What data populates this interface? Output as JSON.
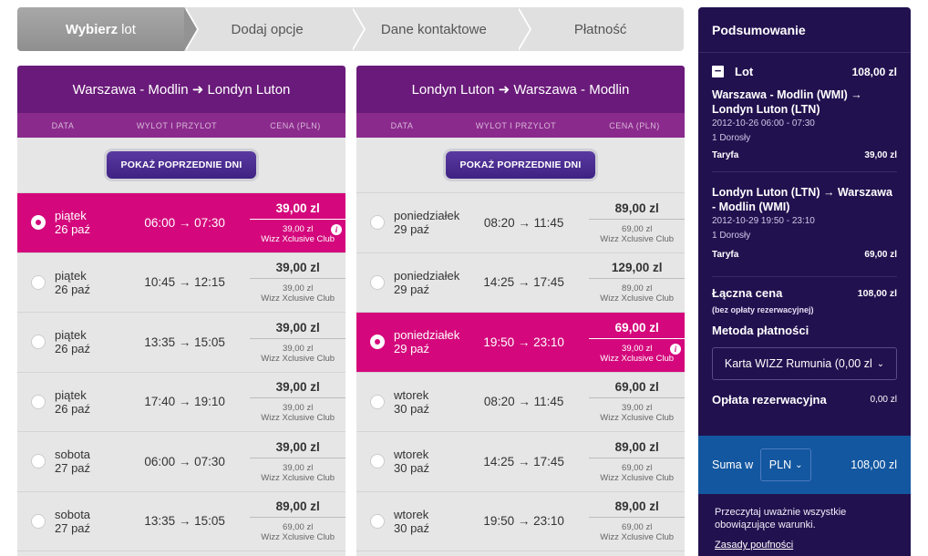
{
  "steps": [
    {
      "bold": "Wybierz",
      "rest": "lot",
      "active": true
    },
    {
      "bold": "",
      "rest": "Dodaj opcje",
      "active": false
    },
    {
      "bold": "",
      "rest": "Dane kontaktowe",
      "active": false
    },
    {
      "bold": "",
      "rest": "Płatność",
      "active": false
    }
  ],
  "outbound": {
    "route": "Warszawa - Modlin ➜ Londyn Luton",
    "col_date": "DATA",
    "col_times": "WYLOT I PRZYLOT",
    "col_price": "CENA (PLN)",
    "prev_label": "POKAŻ POPRZEDNIE DNI",
    "rows": [
      {
        "day": "piątek",
        "date": "26 paź",
        "times": "06:00 → 07:30",
        "price": "39,00 zl",
        "club_price": "39,00 zl",
        "club": "Wizz Xclusive Club",
        "selected": true
      },
      {
        "day": "piątek",
        "date": "26 paź",
        "times": "10:45 → 12:15",
        "price": "39,00 zl",
        "club_price": "39,00 zl",
        "club": "Wizz Xclusive Club",
        "selected": false
      },
      {
        "day": "piątek",
        "date": "26 paź",
        "times": "13:35 → 15:05",
        "price": "39,00 zl",
        "club_price": "39,00 zl",
        "club": "Wizz Xclusive Club",
        "selected": false
      },
      {
        "day": "piątek",
        "date": "26 paź",
        "times": "17:40 → 19:10",
        "price": "39,00 zl",
        "club_price": "39,00 zl",
        "club": "Wizz Xclusive Club",
        "selected": false
      },
      {
        "day": "sobota",
        "date": "27 paź",
        "times": "06:00 → 07:30",
        "price": "39,00 zl",
        "club_price": "39,00 zl",
        "club": "Wizz Xclusive Club",
        "selected": false
      },
      {
        "day": "sobota",
        "date": "27 paź",
        "times": "13:35 → 15:05",
        "price": "89,00 zl",
        "club_price": "69,00 zl",
        "club": "Wizz Xclusive Club",
        "selected": false
      }
    ]
  },
  "inbound": {
    "route": "Londyn Luton ➜ Warszawa - Modlin",
    "col_date": "DATA",
    "col_times": "WYLOT I PRZYLOT",
    "col_price": "CENA (PLN)",
    "prev_label": "POKAŻ POPRZEDNIE DNI",
    "rows": [
      {
        "day": "poniedziałek",
        "date": "29 paź",
        "times": "08:20 → 11:45",
        "price": "89,00 zl",
        "club_price": "69,00 zl",
        "club": "Wizz Xclusive Club",
        "selected": false
      },
      {
        "day": "poniedziałek",
        "date": "29 paź",
        "times": "14:25 → 17:45",
        "price": "129,00 zl",
        "club_price": "89,00 zl",
        "club": "Wizz Xclusive Club",
        "selected": false
      },
      {
        "day": "poniedziałek",
        "date": "29 paź",
        "times": "19:50 → 23:10",
        "price": "69,00 zl",
        "club_price": "39,00 zl",
        "club": "Wizz Xclusive Club",
        "selected": true
      },
      {
        "day": "wtorek",
        "date": "30 paź",
        "times": "08:20 → 11:45",
        "price": "69,00 zl",
        "club_price": "39,00 zl",
        "club": "Wizz Xclusive Club",
        "selected": false
      },
      {
        "day": "wtorek",
        "date": "30 paź",
        "times": "14:25 → 17:45",
        "price": "89,00 zl",
        "club_price": "69,00 zl",
        "club": "Wizz Xclusive Club",
        "selected": false
      },
      {
        "day": "wtorek",
        "date": "30 paź",
        "times": "19:50 → 23:10",
        "price": "89,00 zl",
        "club_price": "69,00 zl",
        "club": "Wizz Xclusive Club",
        "selected": false
      }
    ]
  },
  "summary": {
    "title": "Podsumowanie",
    "lot_label": "Lot",
    "lot_amount": "108,00 zl",
    "segments": [
      {
        "route": "Warszawa - Modlin (WMI) → Londyn Luton (LTN)",
        "datetime": "2012-10-26 06:00 - 07:30",
        "pax": "1 Dorosły",
        "fare_label": "Taryfa",
        "fare_value": "39,00 zl"
      },
      {
        "route": "Londyn Luton (LTN) → Warszawa - Modlin (WMI)",
        "datetime": "2012-10-29 19:50 - 23:10",
        "pax": "1 Dorosły",
        "fare_label": "Taryfa",
        "fare_value": "69,00 zl"
      }
    ],
    "total_label": "Łączna cena",
    "total_value": "108,00 zl",
    "total_note": "(bez opłaty rezerwacyjnej)",
    "payment_label": "Metoda płatności",
    "payment_value": "Karta WIZZ Rumunia (0,00 zl",
    "fee_label": "Opłata rezerwacyjna",
    "fee_value": "0,00 zl",
    "sum_label": "Suma w",
    "currency": "PLN",
    "sum_value": "108,00 zl",
    "terms_text": "Przeczytaj uważnie wszystkie obowiązujące warunki.",
    "privacy_link": "Zasady poufności"
  },
  "colors": {
    "purple_header": "#6a1a7a",
    "magenta_selected": "#d4087c",
    "summary_bg": "#22114f",
    "sum_band": "#1357a0"
  }
}
